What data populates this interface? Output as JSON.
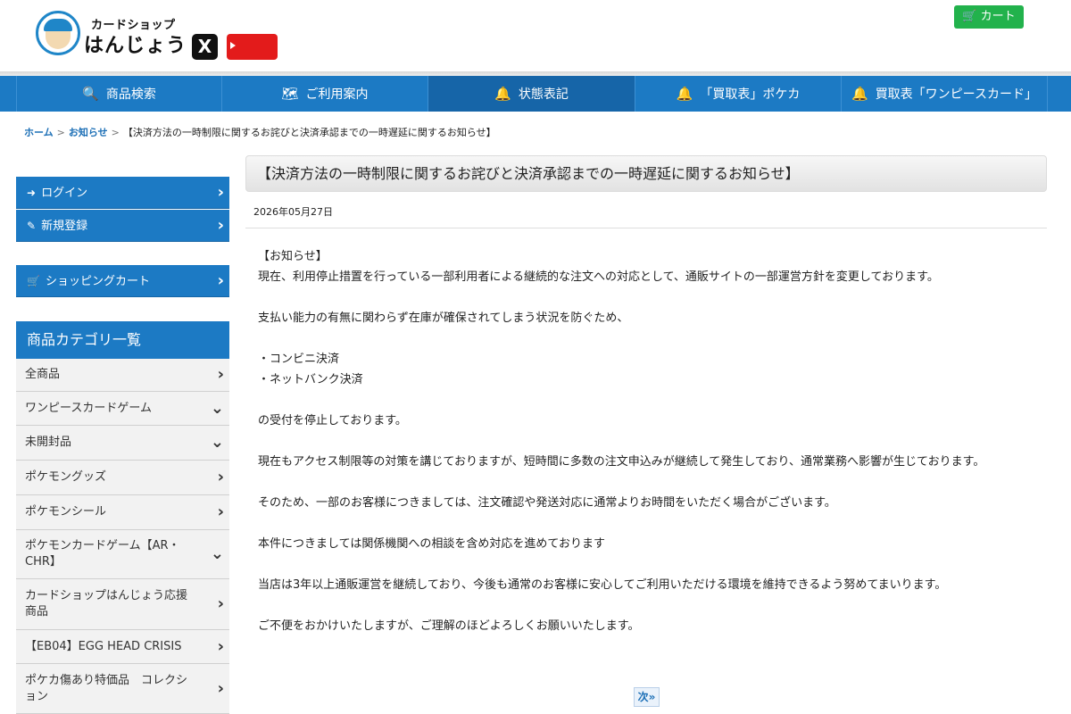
{
  "header": {
    "logo_sub": "カードショップ",
    "logo_main": "はんじょう",
    "x_icon_text": "X",
    "youtube_label": "YouTube",
    "cart_label": "カート"
  },
  "nav": {
    "items": [
      {
        "label": "商品検索",
        "icon": "search-icon"
      },
      {
        "label": "ご利用案内",
        "icon": "map-icon"
      },
      {
        "label": "状態表記",
        "icon": "bell-icon"
      },
      {
        "label": "「買取表」ポケカ",
        "icon": "bell-icon"
      },
      {
        "label": "買取表「ワンピースカード」",
        "icon": "bell-icon"
      }
    ]
  },
  "breadcrumb": {
    "home": "ホーム",
    "news": "お知らせ",
    "current": "【決済方法の一時制限に関するお詫びと決済承認までの一時遅延に関するお知らせ】"
  },
  "sidebar": {
    "login": "ログイン",
    "register": "新規登録",
    "cart": "ショッピングカート",
    "category_header": "商品カテゴリ一覧",
    "categories": [
      {
        "label": "全商品",
        "arrow": "›"
      },
      {
        "label": "ワンピースカードゲーム",
        "arrow": "⌄"
      },
      {
        "label": "未開封品",
        "arrow": "⌄"
      },
      {
        "label": "ポケモングッズ",
        "arrow": "›"
      },
      {
        "label": "ポケモンシール",
        "arrow": "›"
      },
      {
        "label": "ポケモンカードゲーム【AR・CHR】",
        "arrow": "⌄"
      },
      {
        "label": "カードショップはんじょう応援商品",
        "arrow": "›"
      },
      {
        "label": "【EB04】EGG HEAD CRISIS",
        "arrow": "›"
      },
      {
        "label": "ポケカ傷あり特価品　コレクション",
        "arrow": "›"
      }
    ]
  },
  "article": {
    "title": "【決済方法の一時制限に関するお詫びと決済承認までの一時遅延に関するお知らせ】",
    "date": "2026年05月27日",
    "p1": "【お知らせ】",
    "p2": "現在、利用停止措置を行っている一部利用者による継続的な注文への対応として、通販サイトの一部運営方針を変更しております。",
    "p3": "支払い能力の有無に関わらず在庫が確保されてしまう状況を防ぐため、",
    "p4": "・コンビニ決済",
    "p5": "・ネットバンク決済",
    "p6": "の受付を停止しております。",
    "p7": "現在もアクセス制限等の対策を講じておりますが、短時間に多数の注文申込みが継続して発生しており、通常業務へ影響が生じております。",
    "p8": "そのため、一部のお客様につきましては、注文確認や発送対応に通常よりお時間をいただく場合がございます。",
    "p9": "本件につきましては関係機関への相談を含め対応を進めております",
    "p10": "当店は3年以上通販運営を継続しており、今後も通常のお客様に安心してご利用いただける環境を維持できるよう努めてまいります。",
    "p11": "ご不便をおかけいたしますが、ご理解のほどよろしくお願いいたします。",
    "next_label": "次»"
  },
  "colors": {
    "nav_blue": "#1c7ac4",
    "cart_green": "#22b24c",
    "youtube_red": "#e31b1b"
  }
}
